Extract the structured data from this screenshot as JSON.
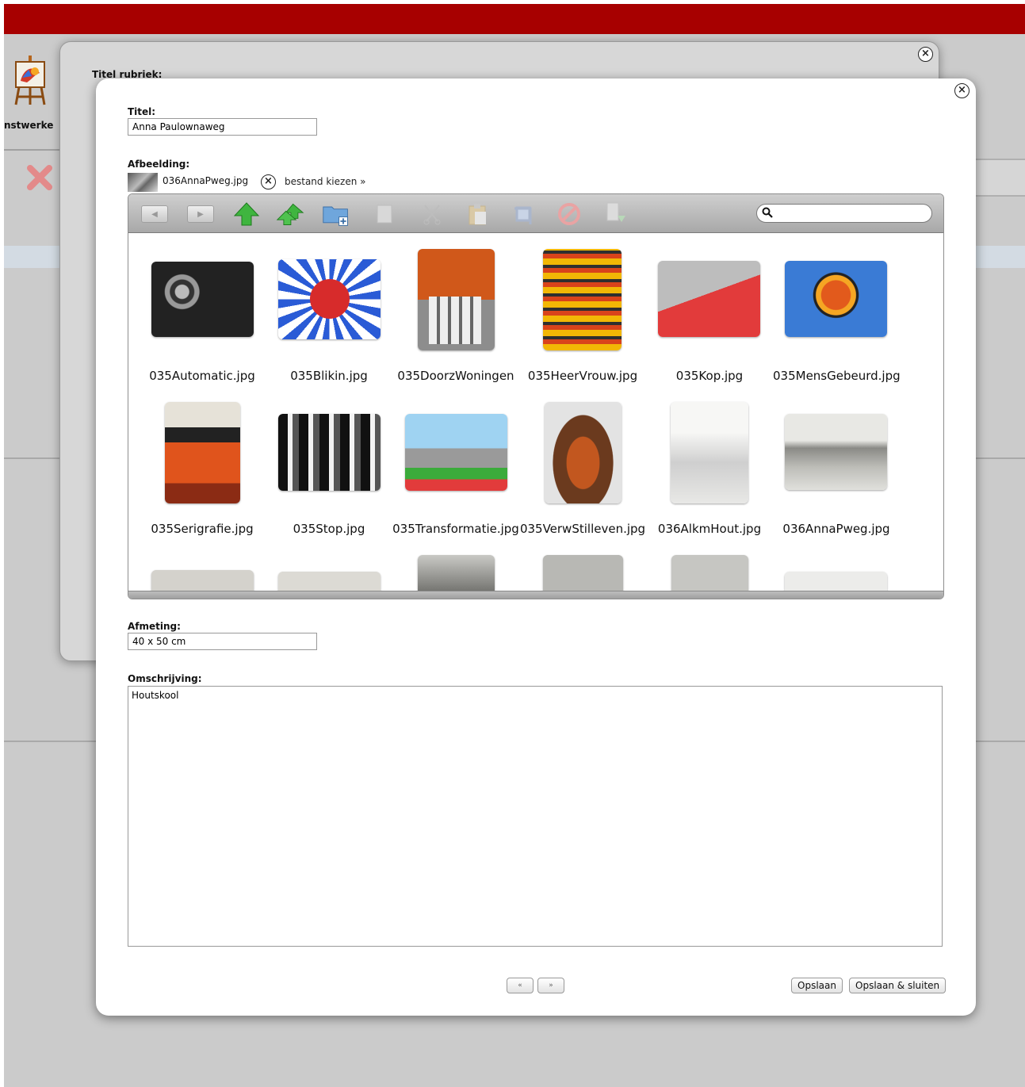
{
  "app": {
    "section_label": "nstwerke",
    "colors": {
      "brand_bar": "#a70000"
    }
  },
  "back_modal": {
    "title_label": "Titel rubriek:"
  },
  "edit_form": {
    "title_label": "Titel:",
    "title_value": "Anna Paulownaweg",
    "image_label": "Afbeelding:",
    "current_file": "036AnnaPweg.jpg",
    "remove_icon": "close-circle-icon",
    "choose_file": "bestand kiezen »",
    "size_label": "Afmeting:",
    "size_value": "40 x 50 cm",
    "description_label": "Omschrijving:",
    "description_value": "Houtskool"
  },
  "file_browser": {
    "toolbar_icons": [
      "back-icon",
      "forward-icon",
      "up-folder-icon",
      "upload-icon",
      "new-folder-icon",
      "copy-icon",
      "cut-icon",
      "paste-icon",
      "crop-icon",
      "delete-icon",
      "download-icon"
    ],
    "search_placeholder": "",
    "files": [
      "035Automatic.jpg",
      "035Blikin.jpg",
      "035DoorzWoningen",
      "035HeerVrouw.jpg",
      "035Kop.jpg",
      "035MensGebeurd.jpg",
      "035Serigrafie.jpg",
      "035Stop.jpg",
      "035Transformatie.jpg",
      "035VerwStilleven.jpg",
      "036AlkmHout.jpg",
      "036AnnaPweg.jpg"
    ]
  },
  "footer": {
    "prev_label": "«",
    "next_label": "»",
    "save_label": "Opslaan",
    "save_close_label": "Opslaan & sluiten"
  }
}
